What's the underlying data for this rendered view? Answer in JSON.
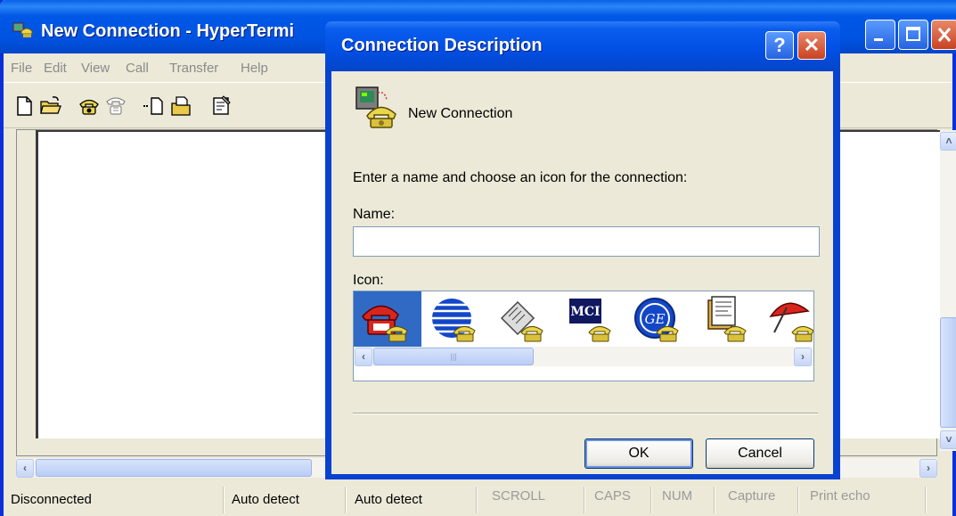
{
  "window": {
    "title": "New Connection - HyperTermi",
    "buttons": [
      "minimize-icon",
      "maximize-icon",
      "close-icon"
    ]
  },
  "menu": [
    "File",
    "Edit",
    "View",
    "Call",
    "Transfer",
    "Help"
  ],
  "toolbar": [
    "new-file-icon",
    "open-folder-icon",
    "dial-icon",
    "disconnect-icon",
    "send-icon",
    "receive-icon",
    "properties-icon"
  ],
  "status": {
    "connection": "Disconnected",
    "detect1": "Auto detect",
    "detect2": "Auto detect",
    "scroll": "SCROLL",
    "caps": "CAPS",
    "num": "NUM",
    "capture": "Capture",
    "print_echo": "Print echo"
  },
  "dialog": {
    "title": "Connection Description",
    "help_label": "?",
    "close_label": "✕",
    "heading": "New Connection",
    "prompt": "Enter a name and choose an icon for the connection:",
    "name_label": "Name:",
    "name_value": "",
    "icon_label": "Icon:",
    "icons": [
      "red-phone-icon",
      "globe-phone-icon",
      "fax-phone-icon",
      "mci-phone-icon",
      "ge-phone-icon",
      "document-phone-icon",
      "umbrella-phone-icon"
    ],
    "selected_icon_index": 0,
    "ok_label": "OK",
    "cancel_label": "Cancel"
  },
  "colors": {
    "titlebar": "#0053E1",
    "face": "#ECE9D8",
    "selection": "#316AC5",
    "close_red": "#C94224"
  }
}
